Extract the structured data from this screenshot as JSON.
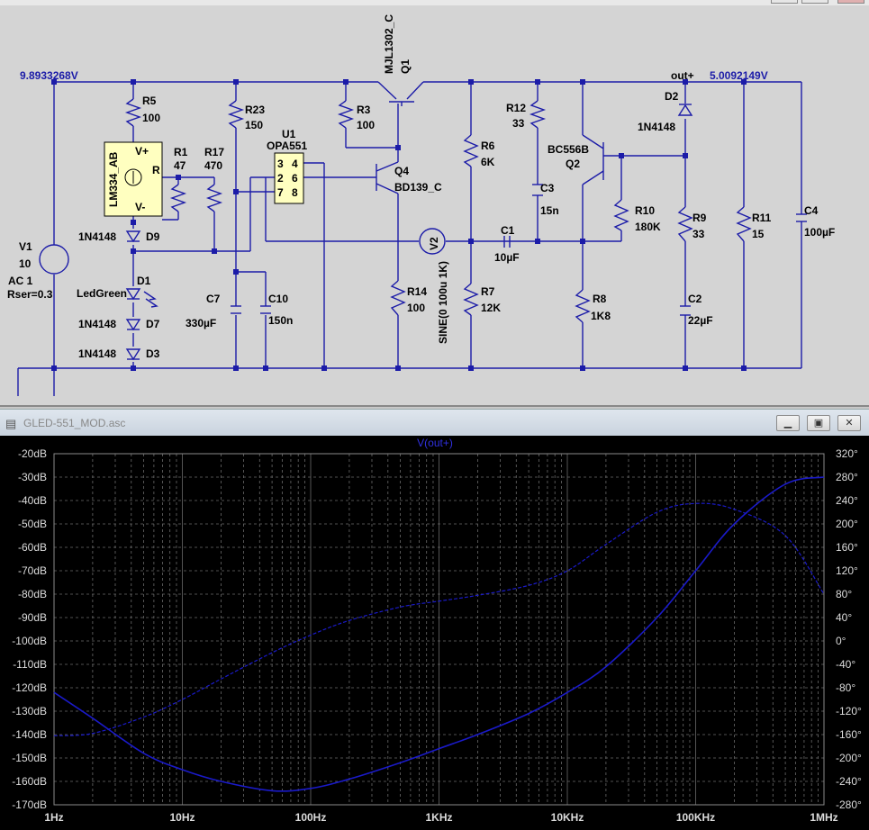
{
  "schematic": {
    "node_voltage_left": "9.8933268V",
    "node_voltage_right": "5.0092149V",
    "out_label": "out+",
    "components": {
      "r5": {
        "ref": "R5",
        "value": "100"
      },
      "r1": {
        "ref": "R1",
        "value": "47"
      },
      "r17": {
        "ref": "R17",
        "value": "470"
      },
      "r23": {
        "ref": "R23",
        "value": "150"
      },
      "u1": {
        "ref": "U1",
        "value": "OPA551"
      },
      "u2": {
        "ref": "LM334_AB",
        "pin_vp": "V+",
        "pin_r": "R",
        "pin_vm": "V-"
      },
      "q1": {
        "ref": "Q1",
        "value": "MJL1302_C"
      },
      "r3": {
        "ref": "R3",
        "value": "100"
      },
      "q4": {
        "ref": "Q4",
        "value": "BD139_C"
      },
      "r14": {
        "ref": "R14",
        "value": "100"
      },
      "v2": {
        "ref": "V2",
        "value": "SINE(0 100u 1K)"
      },
      "r6": {
        "ref": "R6",
        "value": "6K"
      },
      "r7": {
        "ref": "R7",
        "value": "12K"
      },
      "c1": {
        "ref": "C1",
        "value": "10µF"
      },
      "r12": {
        "ref": "R12",
        "value": "33"
      },
      "c3": {
        "ref": "C3",
        "value": "15n"
      },
      "q2": {
        "ref": "Q2",
        "value": "BC556B"
      },
      "r10": {
        "ref": "R10",
        "value": "180K"
      },
      "r8": {
        "ref": "R8",
        "value": "1K8"
      },
      "d2": {
        "ref": "D2",
        "value": "1N4148"
      },
      "r9": {
        "ref": "R9",
        "value": "33"
      },
      "c2": {
        "ref": "C2",
        "value": "22µF"
      },
      "r11": {
        "ref": "R11",
        "value": "15"
      },
      "c4": {
        "ref": "C4",
        "value": "100µF"
      },
      "c7": {
        "ref": "C7",
        "value": "330µF"
      },
      "c10": {
        "ref": "C10",
        "value": "150n"
      },
      "v1": {
        "ref": "V1",
        "value": "10",
        "ac": "AC 1",
        "rser": "Rser=0.3"
      },
      "d9": {
        "ref": "D9",
        "value": "1N4148"
      },
      "d1": {
        "ref": "D1",
        "value": "LedGreen"
      },
      "d7": {
        "ref": "D7",
        "value": "1N4148"
      },
      "d3": {
        "ref": "D3",
        "value": "1N4148"
      }
    },
    "opamp_pins": {
      "p3": "3",
      "p4": "4",
      "p2": "2",
      "p6": "6",
      "p7": "7",
      "p8": "8"
    }
  },
  "plot_window": {
    "title": "GLED-551_MOD.asc",
    "trace_label": "V(out+)",
    "minimize_icon": "minimize-icon",
    "restore_icon": "restore-icon",
    "close_icon": "close-icon"
  },
  "chart_data": {
    "type": "line",
    "title": "V(out+)",
    "x_scale": "log",
    "xlim": [
      1,
      1000000
    ],
    "x_tick_labels": [
      "1Hz",
      "10Hz",
      "100Hz",
      "1KHz",
      "10KHz",
      "100KHz",
      "1MHz"
    ],
    "ylim_left": [
      -170,
      -20
    ],
    "y_left_tick_labels": [
      "-20dB",
      "-30dB",
      "-40dB",
      "-50dB",
      "-60dB",
      "-70dB",
      "-80dB",
      "-90dB",
      "-100dB",
      "-110dB",
      "-120dB",
      "-130dB",
      "-140dB",
      "-150dB",
      "-160dB",
      "-170dB"
    ],
    "ylim_right": [
      -280,
      320
    ],
    "y_right_tick_labels": [
      "320°",
      "280°",
      "240°",
      "200°",
      "160°",
      "120°",
      "80°",
      "40°",
      "0°",
      "-40°",
      "-80°",
      "-120°",
      "-160°",
      "-200°",
      "-240°",
      "-280°"
    ],
    "grid": true,
    "background": "#000000",
    "trace_color": "#1a1ac8",
    "series": [
      {
        "name": "magnitude",
        "unit": "dB",
        "x": [
          1,
          2,
          5,
          10,
          20,
          50,
          100,
          200,
          500,
          1000,
          2000,
          5000,
          10000,
          20000,
          50000,
          100000,
          200000,
          500000,
          1000000
        ],
        "y": [
          -122,
          -133,
          -148,
          -155,
          -160,
          -164,
          -163,
          -159,
          -152,
          -146,
          -140,
          -131,
          -122,
          -111,
          -90,
          -70,
          -50,
          -33,
          -30
        ]
      },
      {
        "name": "phase",
        "unit": "°",
        "x": [
          1,
          2,
          5,
          10,
          20,
          50,
          100,
          200,
          500,
          1000,
          2000,
          5000,
          10000,
          20000,
          50000,
          100000,
          200000,
          500000,
          1000000
        ],
        "y": [
          -162,
          -158,
          -130,
          -100,
          -65,
          -20,
          10,
          35,
          58,
          68,
          78,
          95,
          120,
          165,
          220,
          235,
          225,
          180,
          80
        ]
      }
    ]
  }
}
